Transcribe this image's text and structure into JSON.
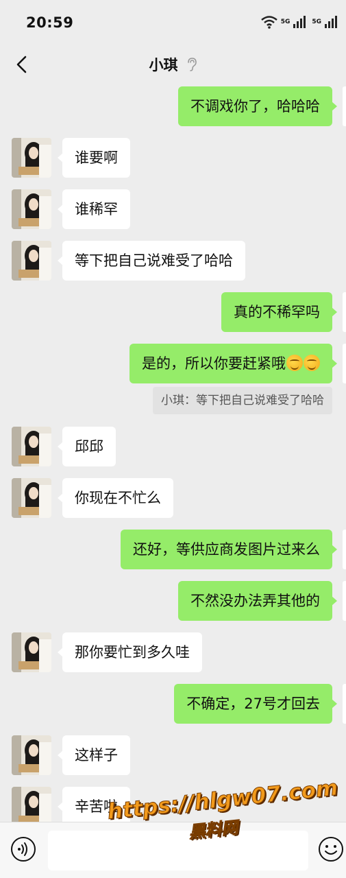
{
  "status_bar": {
    "time": "20:59",
    "network_1": "5G",
    "network_2": "5G"
  },
  "header": {
    "title": "小琪"
  },
  "messages": [
    {
      "side": "out",
      "text": "不调戏你了，哈哈哈"
    },
    {
      "side": "in",
      "text": "谁要啊"
    },
    {
      "side": "in",
      "text": "谁稀罕"
    },
    {
      "side": "in",
      "text": "等下把自己说难受了哈哈"
    },
    {
      "side": "out",
      "text": "真的不稀罕吗"
    },
    {
      "side": "out",
      "text": "是的，所以你要赶紧哦"
    },
    {
      "side": "quote",
      "text": "小琪：等下把自己说难受了哈哈"
    },
    {
      "side": "in",
      "text": "邱邱"
    },
    {
      "side": "in",
      "text": "你现在不忙么"
    },
    {
      "side": "out",
      "text": "还好，等供应商发图片过来么"
    },
    {
      "side": "out",
      "text": "不然没办法弄其他的"
    },
    {
      "side": "in",
      "text": "那你要忙到多久哇"
    },
    {
      "side": "out",
      "text": "不确定，27号才回去"
    },
    {
      "side": "in",
      "text": "这样子"
    },
    {
      "side": "in",
      "text": "辛苦啦"
    }
  ],
  "emoji_names": [
    "grimace-emoji",
    "grimace-emoji"
  ],
  "colors": {
    "background": "#ededed",
    "outgoing_bubble": "#95ec69",
    "incoming_bubble": "#ffffff"
  },
  "watermark": {
    "url": "https://hlgw07.com",
    "name": "黑料网"
  }
}
